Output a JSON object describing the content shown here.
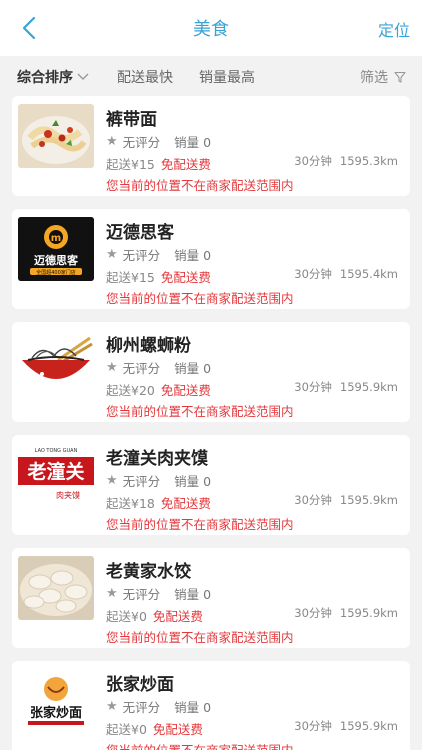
{
  "nav": {
    "title": "美食",
    "right": "定位"
  },
  "filters": {
    "sort": "综合排序",
    "fast": "配送最快",
    "sales": "销量最高",
    "screen": "筛选"
  },
  "shops": [
    {
      "name": "裤带面",
      "rating": "无评分",
      "sales": "销量 0",
      "min": "起送¥15",
      "free": "免配送费",
      "time": "30分钟",
      "distance": "1595.3km",
      "warn": "您当前的位置不在商家配送范围内",
      "thumb": "noodle-dish-photo"
    },
    {
      "name": "迈德思客",
      "rating": "无评分",
      "sales": "销量 0",
      "min": "起送¥15",
      "free": "免配送费",
      "time": "30分钟",
      "distance": "1595.4km",
      "warn": "您当前的位置不在商家配送范围内",
      "thumb": "maidesike-logo",
      "logo_text": "迈德思客",
      "logo_sub": "全国超400家门店"
    },
    {
      "name": "柳州螺蛳粉",
      "rating": "无评分",
      "sales": "销量 0",
      "min": "起送¥20",
      "free": "免配送费",
      "time": "30分钟",
      "distance": "1595.9km",
      "warn": "您当前的位置不在商家配送范围内",
      "thumb": "noodle-bowl-illustration"
    },
    {
      "name": "老潼关肉夹馍",
      "rating": "无评分",
      "sales": "销量 0",
      "min": "起送¥18",
      "free": "免配送费",
      "time": "30分钟",
      "distance": "1595.9km",
      "warn": "您当前的位置不在商家配送范围内",
      "thumb": "laotongguan-logo",
      "logo_text": "老潼关",
      "logo_en": "LAO TONG GUAN",
      "logo_sub": "肉夹馍"
    },
    {
      "name": "老黄家水饺",
      "rating": "无评分",
      "sales": "销量 0",
      "min": "起送¥0",
      "free": "免配送费",
      "time": "30分钟",
      "distance": "1595.9km",
      "warn": "您当前的位置不在商家配送范围内",
      "thumb": "dumplings-photo"
    },
    {
      "name": "张家炒面",
      "rating": "无评分",
      "sales": "销量 0",
      "min": "起送¥0",
      "free": "免配送费",
      "time": "30分钟",
      "distance": "1595.9km",
      "warn": "您当前的位置不在商家配送范围内",
      "thumb": "zhangjia-logo",
      "logo_text": "张家炒面"
    }
  ],
  "colors": {
    "accent": "#3aa3d6",
    "warn": "#e4383c",
    "background": "#f2f2f2"
  }
}
